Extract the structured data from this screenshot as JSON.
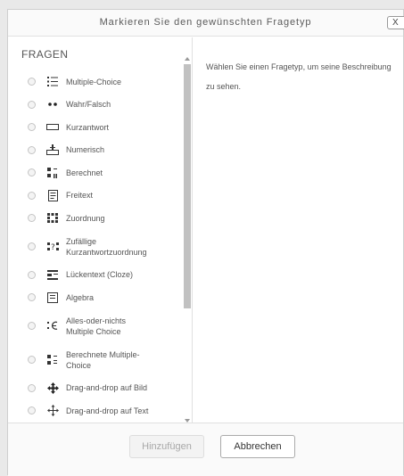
{
  "dialog": {
    "title": "Markieren Sie den gewünschten Fragetyp",
    "close_label": "X"
  },
  "list": {
    "section_title": "FRAGEN",
    "items": [
      {
        "label": "Multiple-Choice",
        "icon": "list-icon"
      },
      {
        "label": "Wahr/Falsch",
        "icon": "dots-icon"
      },
      {
        "label": "Kurzantwort",
        "icon": "textbox-icon"
      },
      {
        "label": "Numerisch",
        "icon": "numeric-icon"
      },
      {
        "label": "Berechnet",
        "icon": "calculated-icon"
      },
      {
        "label": "Freitext",
        "icon": "essay-icon"
      },
      {
        "label": "Zuordnung",
        "icon": "matching-icon"
      },
      {
        "label": "Zufällige Kurzantwortzuordnung",
        "icon": "random-match-icon"
      },
      {
        "label": "Lückentext (Cloze)",
        "icon": "cloze-icon"
      },
      {
        "label": "Algebra",
        "icon": "algebra-icon"
      },
      {
        "label": "Alles-oder-nichts Multiple Choice",
        "icon": "all-or-nothing-icon"
      },
      {
        "label": "Berechnete Multiple-Choice",
        "icon": "calc-multichoice-icon"
      },
      {
        "label": "Drag-and-drop auf Bild",
        "icon": "drag-image-icon"
      },
      {
        "label": "Drag-and-drop auf Text",
        "icon": "drag-text-icon"
      }
    ]
  },
  "description": "Wählen Sie einen Fragetyp, um seine Beschreibung zu sehen.",
  "footer": {
    "add_label": "Hinzufügen",
    "cancel_label": "Abbrechen"
  }
}
